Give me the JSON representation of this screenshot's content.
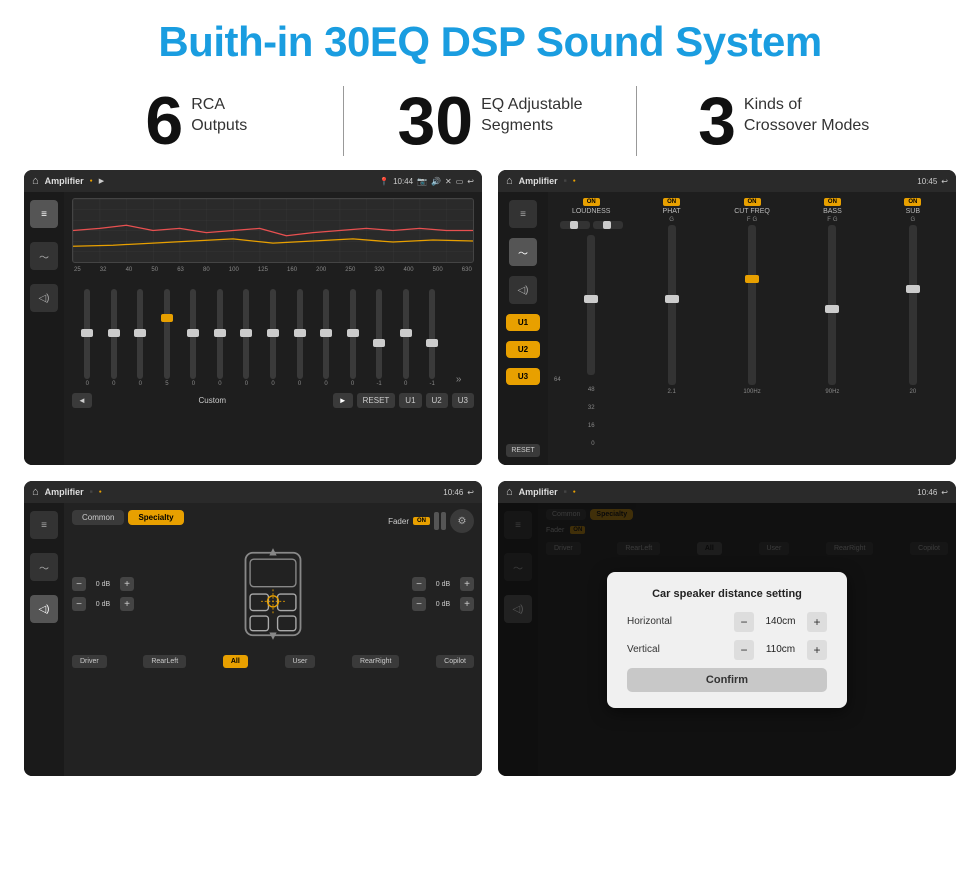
{
  "page": {
    "title": "Buith-in 30EQ DSP Sound System",
    "bg_color": "#ffffff"
  },
  "stats": [
    {
      "number": "6",
      "label": "RCA\nOutputs"
    },
    {
      "number": "30",
      "label": "EQ Adjustable\nSegments"
    },
    {
      "number": "3",
      "label": "Kinds of\nCrossover Modes"
    }
  ],
  "screens": [
    {
      "id": "screen1",
      "topbar": {
        "title": "Amplifier",
        "time": "10:44"
      },
      "eq_freqs": [
        "25",
        "32",
        "40",
        "50",
        "63",
        "80",
        "100",
        "125",
        "160",
        "200",
        "250",
        "320",
        "400",
        "500",
        "630"
      ],
      "eq_values": [
        "0",
        "0",
        "0",
        "5",
        "0",
        "0",
        "0",
        "0",
        "0",
        "0",
        "0",
        "-1",
        "0",
        "-1"
      ],
      "bottom_buttons": [
        "◄",
        "Custom",
        "►",
        "RESET",
        "U1",
        "U2",
        "U3"
      ]
    },
    {
      "id": "screen2",
      "topbar": {
        "title": "Amplifier",
        "time": "10:45"
      },
      "u_buttons": [
        "U1",
        "U2",
        "U3"
      ],
      "channels": [
        "LOUDNESS",
        "PHAT",
        "CUT FREQ",
        "BASS",
        "SUB"
      ],
      "reset_label": "RESET"
    },
    {
      "id": "screen3",
      "topbar": {
        "title": "Amplifier",
        "time": "10:46"
      },
      "tabs": [
        "Common",
        "Specialty"
      ],
      "active_tab": "Specialty",
      "fader_label": "Fader",
      "on_label": "ON",
      "vol_left1": "0 dB",
      "vol_left2": "0 dB",
      "vol_right1": "0 dB",
      "vol_right2": "0 dB",
      "bottom_buttons": [
        "Driver",
        "RearLeft",
        "All",
        "User",
        "RearRight",
        "Copilot"
      ]
    },
    {
      "id": "screen4",
      "topbar": {
        "title": "Amplifier",
        "time": "10:46"
      },
      "dialog": {
        "title": "Car speaker distance setting",
        "horizontal_label": "Horizontal",
        "horizontal_value": "140cm",
        "vertical_label": "Vertical",
        "vertical_value": "110cm",
        "confirm_label": "Confirm"
      }
    }
  ]
}
